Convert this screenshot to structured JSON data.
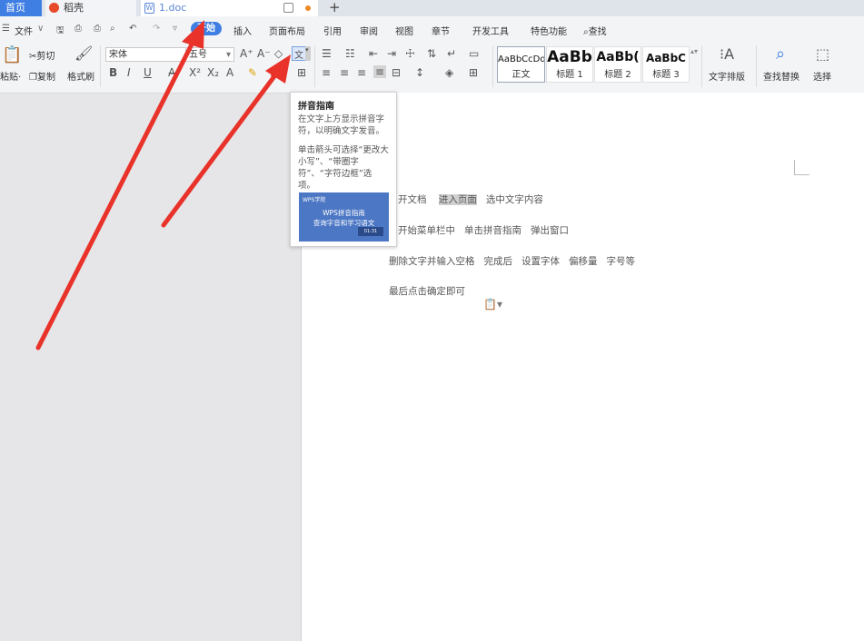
{
  "tabs": {
    "home": "首页",
    "daoke": "稻壳",
    "doc": "1.doc",
    "new_tab": "+"
  },
  "menu": {
    "file": "文件",
    "start": "开始",
    "insert": "插入",
    "layout": "页面布局",
    "references": "引用",
    "review": "审阅",
    "view": "视图",
    "section": "章节",
    "devtools": "开发工具",
    "special": "特色功能",
    "search": "查找"
  },
  "ribbon": {
    "paste": "粘贴",
    "cut": "剪切",
    "copy": "复制",
    "format_painter": "格式刷",
    "font_name": "宋体",
    "font_size": "五号",
    "text_layout": "文字排版",
    "find_replace": "查找替换",
    "select": "选择",
    "styles": [
      {
        "sample": "AaBbCcDd",
        "name": "正文"
      },
      {
        "sample": "AaBb",
        "name": "标题 1"
      },
      {
        "sample": "AaBb(",
        "name": "标题 2"
      },
      {
        "sample": "AaBbC",
        "name": "标题 3"
      }
    ]
  },
  "tooltip": {
    "title": "拼音指南",
    "desc1": "在文字上方显示拼音字符，以明确文字发音。",
    "desc2": "单击箭头可选择“更改大小写”、“带圈字符”、“字符边框”选项。",
    "img_logo": "WPS学院",
    "img_line1": "WPS拼音指南",
    "img_line2": "查询字音和学习语文",
    "img_btn": "01:31"
  },
  "document": {
    "line1_a": "开文档",
    "line1_hl": "进入页面",
    "line1_b": "选中文字内容",
    "line2": "开始菜单栏中   单击拼音指南   弹出窗口",
    "line3": "删除文字并输入空格   完成后   设置字体   偏移量   字号等",
    "line4": "最后点击确定即可"
  },
  "colors": {
    "accent": "#3f7fe3",
    "arrow": "#e8322a"
  }
}
